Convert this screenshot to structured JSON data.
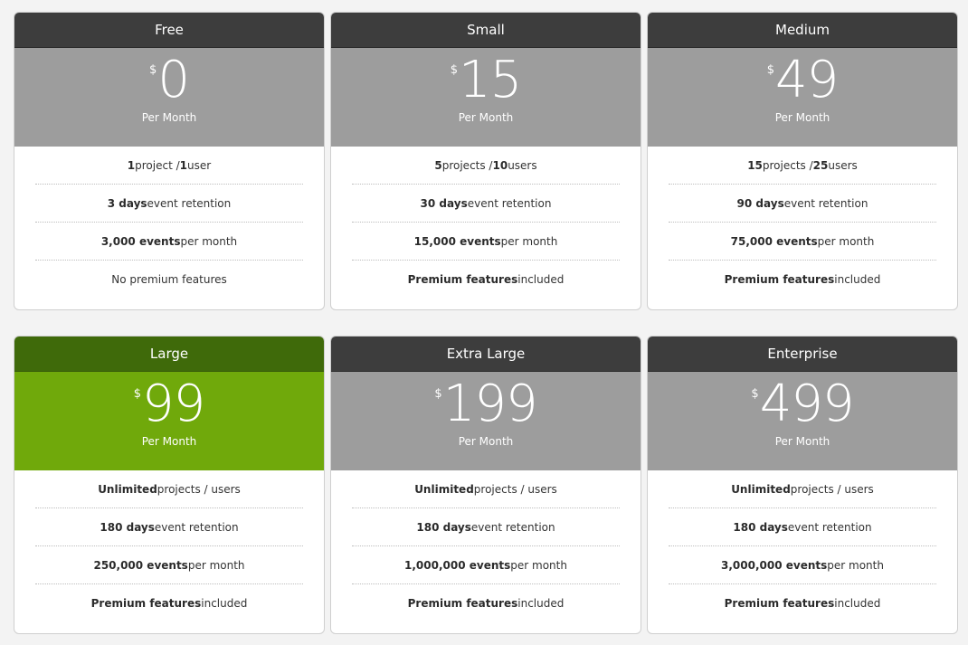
{
  "plans": [
    {
      "name": "Free",
      "currency": "$",
      "price": "0",
      "period": "Per Month",
      "featured": false,
      "features": [
        {
          "pre": "",
          "strong": "1",
          "post": " project / ",
          "strong2": "1",
          "post2": " user"
        },
        {
          "pre": "",
          "strong": "3 days",
          "post": " event retention",
          "strong2": "",
          "post2": ""
        },
        {
          "pre": "",
          "strong": "3,000 events",
          "post": " per month",
          "strong2": "",
          "post2": ""
        },
        {
          "pre": "No premium features",
          "strong": "",
          "post": "",
          "strong2": "",
          "post2": ""
        }
      ]
    },
    {
      "name": "Small",
      "currency": "$",
      "price": "15",
      "period": "Per Month",
      "featured": false,
      "features": [
        {
          "pre": "",
          "strong": "5",
          "post": " projects / ",
          "strong2": "10",
          "post2": " users"
        },
        {
          "pre": "",
          "strong": "30 days",
          "post": " event retention",
          "strong2": "",
          "post2": ""
        },
        {
          "pre": "",
          "strong": "15,000 events",
          "post": " per month",
          "strong2": "",
          "post2": ""
        },
        {
          "pre": "",
          "strong": "Premium features",
          "post": " included",
          "strong2": "",
          "post2": ""
        }
      ]
    },
    {
      "name": "Medium",
      "currency": "$",
      "price": "49",
      "period": "Per Month",
      "featured": false,
      "features": [
        {
          "pre": "",
          "strong": "15",
          "post": " projects / ",
          "strong2": "25",
          "post2": " users"
        },
        {
          "pre": "",
          "strong": "90 days",
          "post": " event retention",
          "strong2": "",
          "post2": ""
        },
        {
          "pre": "",
          "strong": "75,000 events",
          "post": " per month",
          "strong2": "",
          "post2": ""
        },
        {
          "pre": "",
          "strong": "Premium features",
          "post": " included",
          "strong2": "",
          "post2": ""
        }
      ]
    },
    {
      "name": "Large",
      "currency": "$",
      "price": "99",
      "period": "Per Month",
      "featured": true,
      "features": [
        {
          "pre": "",
          "strong": "Unlimited",
          "post": " projects / users",
          "strong2": "",
          "post2": ""
        },
        {
          "pre": "",
          "strong": "180 days",
          "post": " event retention",
          "strong2": "",
          "post2": ""
        },
        {
          "pre": "",
          "strong": "250,000 events",
          "post": " per month",
          "strong2": "",
          "post2": ""
        },
        {
          "pre": "",
          "strong": "Premium features",
          "post": " included",
          "strong2": "",
          "post2": ""
        }
      ]
    },
    {
      "name": "Extra Large",
      "currency": "$",
      "price": "199",
      "period": "Per Month",
      "featured": false,
      "features": [
        {
          "pre": "",
          "strong": "Unlimited",
          "post": " projects / users",
          "strong2": "",
          "post2": ""
        },
        {
          "pre": "",
          "strong": "180 days",
          "post": " event retention",
          "strong2": "",
          "post2": ""
        },
        {
          "pre": "",
          "strong": "1,000,000 events",
          "post": " per month",
          "strong2": "",
          "post2": ""
        },
        {
          "pre": "",
          "strong": "Premium features",
          "post": " included",
          "strong2": "",
          "post2": ""
        }
      ]
    },
    {
      "name": "Enterprise",
      "currency": "$",
      "price": "499",
      "period": "Per Month",
      "featured": false,
      "features": [
        {
          "pre": "",
          "strong": "Unlimited",
          "post": " projects / users",
          "strong2": "",
          "post2": ""
        },
        {
          "pre": "",
          "strong": "180 days",
          "post": " event retention",
          "strong2": "",
          "post2": ""
        },
        {
          "pre": "",
          "strong": "3,000,000 events",
          "post": " per month",
          "strong2": "",
          "post2": ""
        },
        {
          "pre": "",
          "strong": "Premium features",
          "post": " included",
          "strong2": "",
          "post2": ""
        }
      ]
    }
  ],
  "colors": {
    "header_dark": "#3d3d3d",
    "price_gray": "#9d9d9d",
    "featured_header": "#3f6a0a",
    "featured_price": "#70a90b"
  }
}
